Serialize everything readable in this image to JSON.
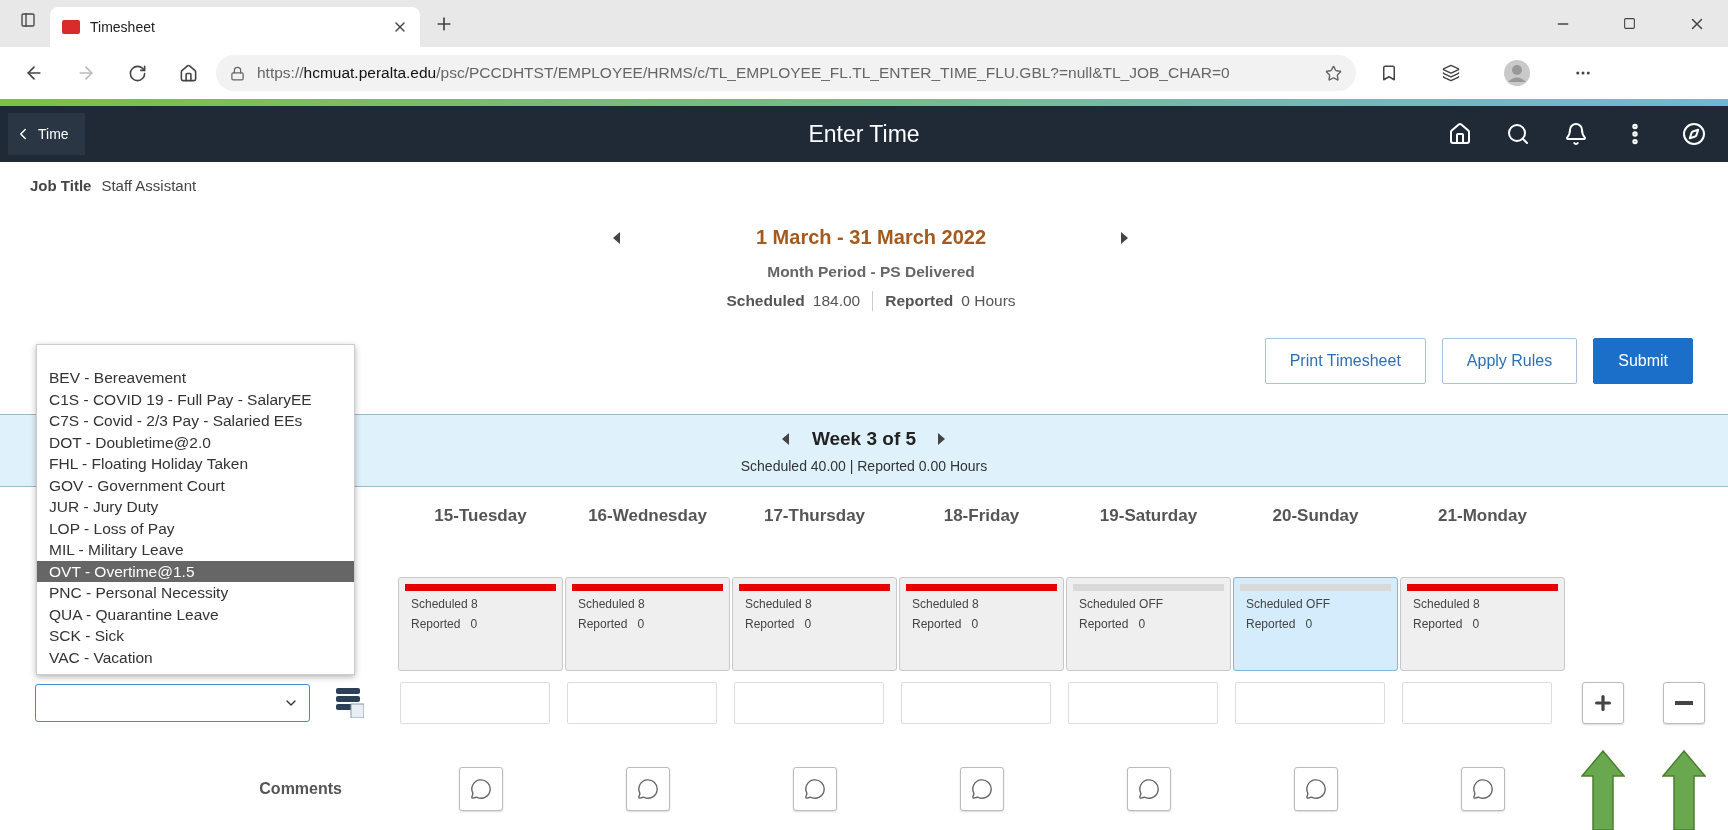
{
  "browser": {
    "tab_title": "Timesheet",
    "url": "https://**hcmuat.peralta.edu**/psc/PCCDHTST/EMPLOYEE/HRMS/c/TL_EMPLOYEE_FL.TL_ENTER_TIME_FLU.GBL?=null&TL_JOB_CHAR=0"
  },
  "nav": {
    "back_label": "Time",
    "title": "Enter Time"
  },
  "job": {
    "label": "Job Title",
    "value": "Staff Assistant"
  },
  "period": {
    "title": "1 March - 31 March 2022",
    "subtitle": "Month Period - PS Delivered",
    "scheduled_label": "Scheduled",
    "scheduled_value": "184.00",
    "reported_label": "Reported",
    "reported_value": "0 Hours"
  },
  "buttons": [
    {
      "label": "Print Timesheet",
      "kind": "secondary"
    },
    {
      "label": "Apply Rules",
      "kind": "secondary"
    },
    {
      "label": "Submit",
      "kind": "primary"
    }
  ],
  "week": {
    "title": "Week 3 of 5",
    "summary": "Scheduled 40.00 | Reported 0.00 Hours"
  },
  "days": [
    {
      "label": "15-Tuesday",
      "scheduled": "Scheduled 8",
      "reported_label": "Reported",
      "reported_value": "0",
      "color": "#e60000",
      "selected": false
    },
    {
      "label": "16-Wednesday",
      "scheduled": "Scheduled 8",
      "reported_label": "Reported",
      "reported_value": "0",
      "color": "#e60000",
      "selected": false
    },
    {
      "label": "17-Thursday",
      "scheduled": "Scheduled 8",
      "reported_label": "Reported",
      "reported_value": "0",
      "color": "#e60000",
      "selected": false
    },
    {
      "label": "18-Friday",
      "scheduled": "Scheduled 8",
      "reported_label": "Reported",
      "reported_value": "0",
      "color": "#e60000",
      "selected": false
    },
    {
      "label": "19-Saturday",
      "scheduled": "Scheduled OFF",
      "reported_label": "Reported",
      "reported_value": "0",
      "color": "#d9d9d9",
      "selected": false
    },
    {
      "label": "20-Sunday",
      "scheduled": "Scheduled OFF",
      "reported_label": "Reported",
      "reported_value": "0",
      "color": "#d9d9d9",
      "selected": true
    },
    {
      "label": "21-Monday",
      "scheduled": "Scheduled 8",
      "reported_label": "Reported",
      "reported_value": "0",
      "color": "#e60000",
      "selected": false
    }
  ],
  "time_code": {
    "expanded": true,
    "options": [
      {
        "label": "BEV - Bereavement",
        "selected": false
      },
      {
        "label": "C1S - COVID 19 - Full Pay - SalaryEE",
        "selected": false
      },
      {
        "label": "C7S - Covid - 2/3 Pay - Salaried EEs",
        "selected": false
      },
      {
        "label": "DOT - Doubletime@2.0",
        "selected": false
      },
      {
        "label": "FHL - Floating Holiday Taken",
        "selected": false
      },
      {
        "label": "GOV - Government Court",
        "selected": false
      },
      {
        "label": "JUR - Jury Duty",
        "selected": false
      },
      {
        "label": "LOP - Loss of Pay",
        "selected": false
      },
      {
        "label": "MIL - Military Leave",
        "selected": false
      },
      {
        "label": "OVT - Overtime@1.5",
        "selected": true
      },
      {
        "label": "PNC - Personal Necessity",
        "selected": false
      },
      {
        "label": "QUA - Quarantine Leave",
        "selected": false
      },
      {
        "label": "SCK - Sick",
        "selected": false
      },
      {
        "label": "VAC - Vacation",
        "selected": false
      }
    ]
  },
  "comments_label": "Comments"
}
